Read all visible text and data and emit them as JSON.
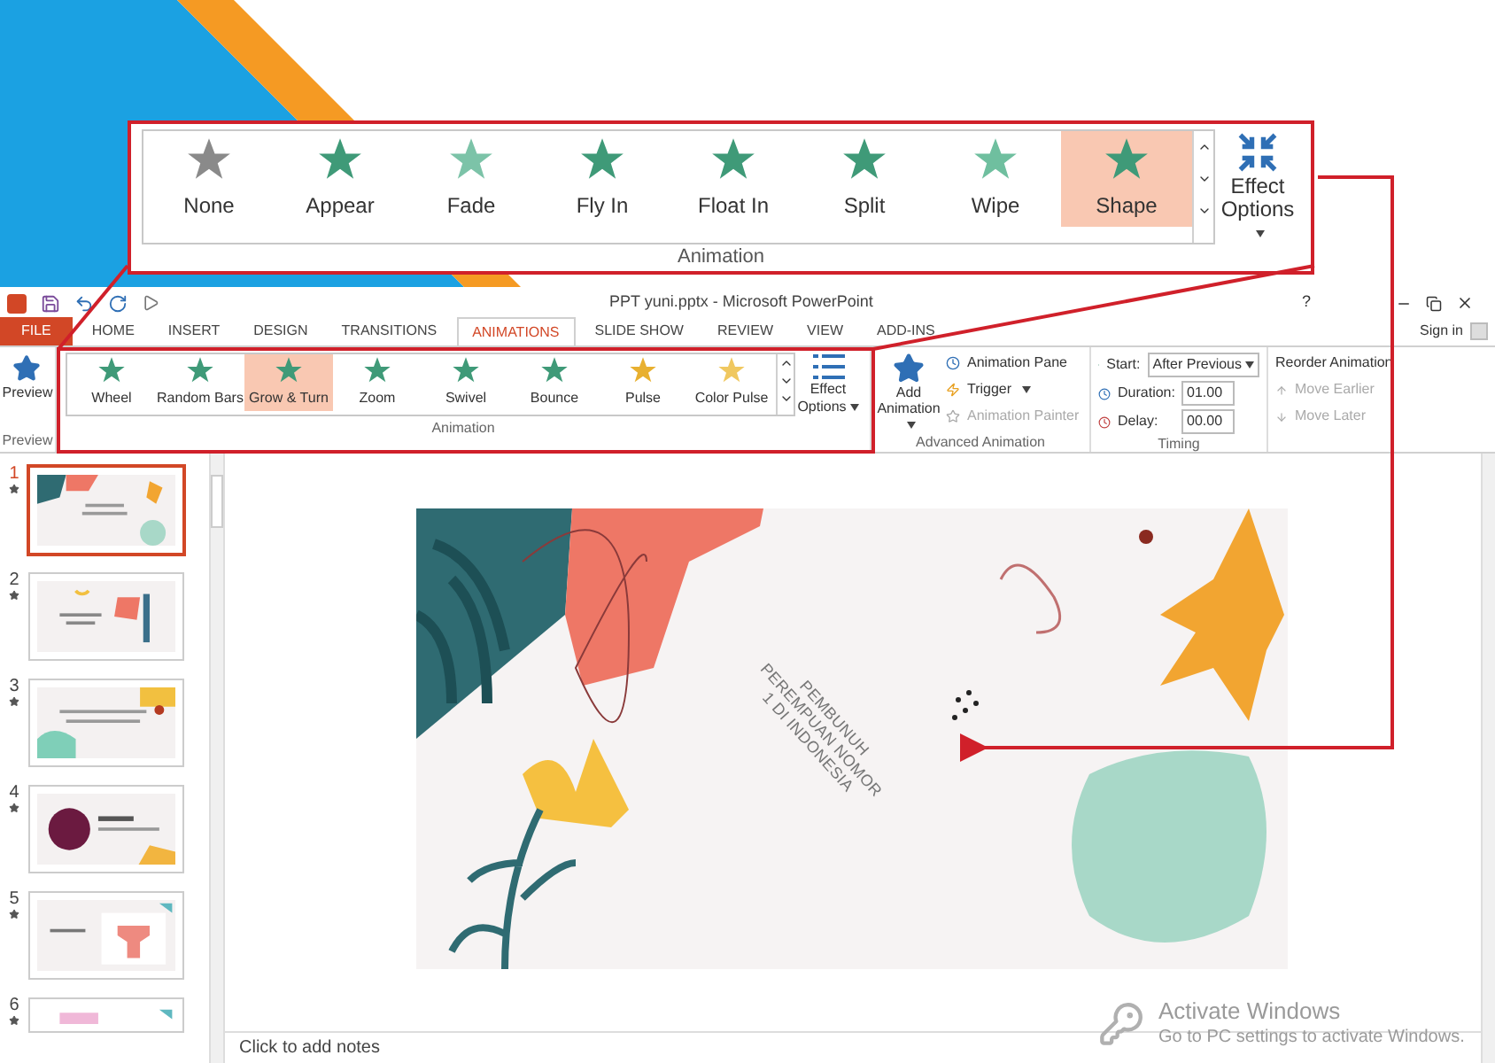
{
  "callout": {
    "gallery": [
      {
        "label": "None",
        "selected": false,
        "color": "#8a8a8a"
      },
      {
        "label": "Appear",
        "selected": false,
        "color": "#3f9a78"
      },
      {
        "label": "Fade",
        "selected": false,
        "color": "#7cc3a8"
      },
      {
        "label": "Fly In",
        "selected": false,
        "color": "#3f9a78"
      },
      {
        "label": "Float In",
        "selected": false,
        "color": "#3f9a78"
      },
      {
        "label": "Split",
        "selected": false,
        "color": "#3f9a78"
      },
      {
        "label": "Wipe",
        "selected": false,
        "color": "#6fbf9f"
      },
      {
        "label": "Shape",
        "selected": true,
        "color": "#3f9a78"
      }
    ],
    "effect_options": "Effect Options",
    "group_label": "Animation"
  },
  "window": {
    "title": "PPT yuni.pptx - Microsoft PowerPoint",
    "help": "?",
    "sign_in": "Sign in"
  },
  "tabs": [
    {
      "label": "FILE",
      "selected": false,
      "kind": "file"
    },
    {
      "label": "HOME",
      "selected": false,
      "kind": "tab"
    },
    {
      "label": "INSERT",
      "selected": false,
      "kind": "tab"
    },
    {
      "label": "DESIGN",
      "selected": false,
      "kind": "tab"
    },
    {
      "label": "TRANSITIONS",
      "selected": false,
      "kind": "tab"
    },
    {
      "label": "ANIMATIONS",
      "selected": true,
      "kind": "tab"
    },
    {
      "label": "SLIDE SHOW",
      "selected": false,
      "kind": "tab"
    },
    {
      "label": "REVIEW",
      "selected": false,
      "kind": "tab"
    },
    {
      "label": "VIEW",
      "selected": false,
      "kind": "tab"
    },
    {
      "label": "ADD-INS",
      "selected": false,
      "kind": "tab"
    }
  ],
  "ribbon": {
    "preview": {
      "label": "Preview",
      "group": "Preview"
    },
    "gallery": [
      {
        "label": "Wheel",
        "selected": false,
        "color": "#3f9a78"
      },
      {
        "label": "Random Bars",
        "selected": false,
        "color": "#3f9a78"
      },
      {
        "label": "Grow & Turn",
        "selected": true,
        "color": "#3f9a78"
      },
      {
        "label": "Zoom",
        "selected": false,
        "color": "#3f9a78"
      },
      {
        "label": "Swivel",
        "selected": false,
        "color": "#3f9a78"
      },
      {
        "label": "Bounce",
        "selected": false,
        "color": "#3f9a78"
      },
      {
        "label": "Pulse",
        "selected": false,
        "color": "#e8b030"
      },
      {
        "label": "Color Pulse",
        "selected": false,
        "color": "#f0c860"
      }
    ],
    "effect_options": "Effect Options",
    "animation_group": "Animation",
    "advanced": {
      "add_animation": "Add Animation",
      "animation_pane": "Animation Pane",
      "trigger": "Trigger",
      "animation_painter": "Animation Painter",
      "animation_painter_disabled": true,
      "group": "Advanced Animation"
    },
    "timing": {
      "start_label": "Start:",
      "start_value": "After Previous",
      "duration_label": "Duration:",
      "duration_value": "01.00",
      "delay_label": "Delay:",
      "delay_value": "00.00",
      "reorder": "Reorder Animation",
      "move_earlier": "Move Earlier",
      "move_earlier_disabled": true,
      "move_later": "Move Later",
      "move_later_disabled": true,
      "group": "Timing"
    }
  },
  "slides": [
    {
      "number": "1",
      "selected": true
    },
    {
      "number": "2",
      "selected": false
    },
    {
      "number": "3",
      "selected": false
    },
    {
      "number": "4",
      "selected": false
    },
    {
      "number": "5",
      "selected": false
    },
    {
      "number": "6",
      "selected": false
    }
  ],
  "slide": {
    "title_lines": [
      "PEMBUNUH",
      "PEREMPUAN NOMOR",
      "1 DI INDONESIA"
    ]
  },
  "notes": {
    "placeholder": "Click to add notes"
  },
  "activation": {
    "title": "Activate Windows",
    "subtitle": "Go to PC settings to activate Windows."
  }
}
